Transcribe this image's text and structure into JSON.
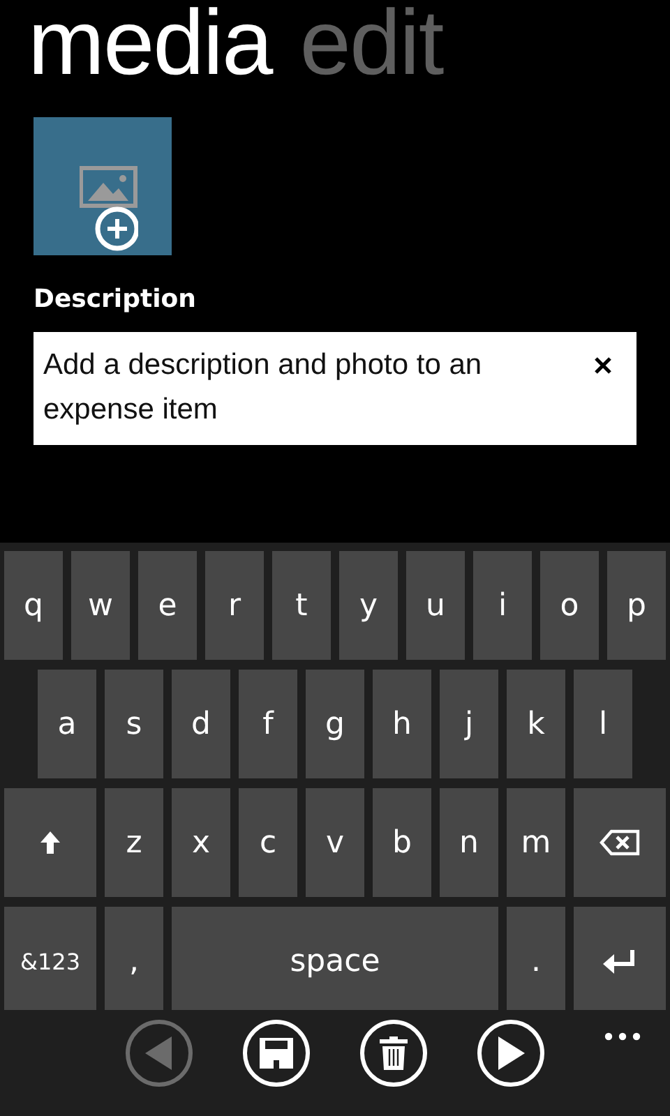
{
  "pivot_headers": [
    {
      "label": "media",
      "selected": true
    },
    {
      "label": "edit",
      "selected": false
    }
  ],
  "photo_tile": {
    "kind": "add-photo"
  },
  "description": {
    "label": "Description",
    "value": "Add a description and photo to an expense item"
  },
  "keyboard": {
    "rows": [
      {
        "keys": [
          {
            "kind": "char",
            "label": "q"
          },
          {
            "kind": "char",
            "label": "w"
          },
          {
            "kind": "char",
            "label": "e"
          },
          {
            "kind": "char",
            "label": "r"
          },
          {
            "kind": "char",
            "label": "t"
          },
          {
            "kind": "char",
            "label": "y"
          },
          {
            "kind": "char",
            "label": "u"
          },
          {
            "kind": "char",
            "label": "i"
          },
          {
            "kind": "char",
            "label": "o"
          },
          {
            "kind": "char",
            "label": "p"
          }
        ]
      },
      {
        "keys": [
          {
            "kind": "char",
            "label": "a"
          },
          {
            "kind": "char",
            "label": "s"
          },
          {
            "kind": "char",
            "label": "d"
          },
          {
            "kind": "char",
            "label": "f"
          },
          {
            "kind": "char",
            "label": "g"
          },
          {
            "kind": "char",
            "label": "h"
          },
          {
            "kind": "char",
            "label": "j"
          },
          {
            "kind": "char",
            "label": "k"
          },
          {
            "kind": "char",
            "label": "l"
          }
        ]
      },
      {
        "keys": [
          {
            "kind": "shift"
          },
          {
            "kind": "char",
            "label": "z"
          },
          {
            "kind": "char",
            "label": "x"
          },
          {
            "kind": "char",
            "label": "c"
          },
          {
            "kind": "char",
            "label": "v"
          },
          {
            "kind": "char",
            "label": "b"
          },
          {
            "kind": "char",
            "label": "n"
          },
          {
            "kind": "char",
            "label": "m"
          },
          {
            "kind": "backspace"
          }
        ]
      },
      {
        "keys": [
          {
            "kind": "symbols",
            "label": "&123"
          },
          {
            "kind": "char",
            "label": ","
          },
          {
            "kind": "space",
            "label": "space"
          },
          {
            "kind": "char",
            "label": "."
          },
          {
            "kind": "enter"
          }
        ]
      }
    ]
  },
  "app_bar": {
    "buttons": [
      {
        "kind": "back",
        "disabled": true
      },
      {
        "kind": "save",
        "disabled": false
      },
      {
        "kind": "delete",
        "disabled": false
      },
      {
        "kind": "next",
        "disabled": false
      }
    ],
    "more": true
  }
}
